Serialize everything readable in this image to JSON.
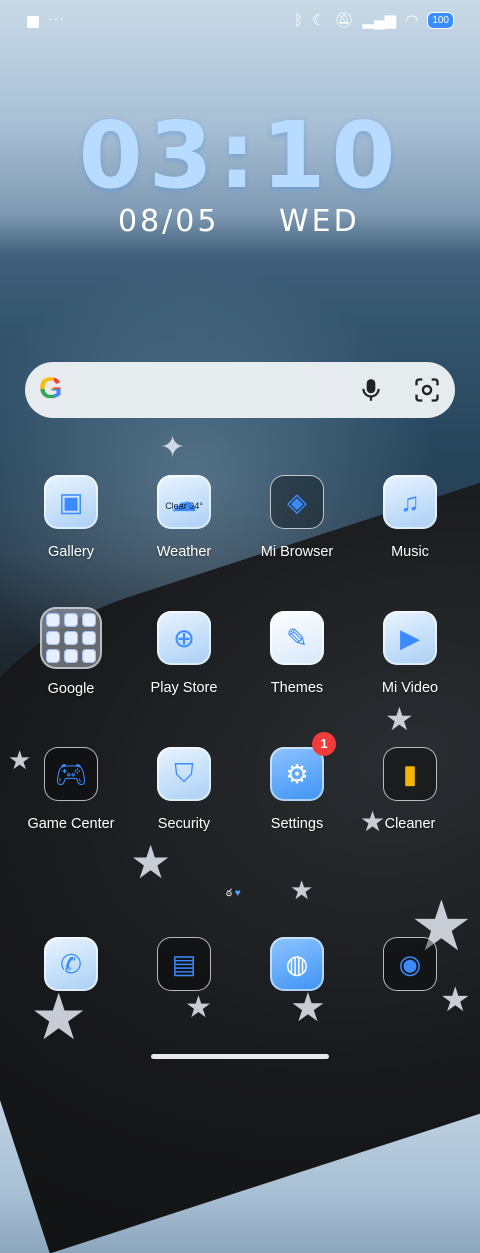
{
  "status_bar": {
    "left_dots": "···",
    "battery": "100",
    "icons": [
      "bluetooth-icon",
      "moon-icon",
      "bell-off-icon",
      "signal-icon",
      "wifi-icon"
    ]
  },
  "lockclock": {
    "time": "03:10",
    "date": "08/05",
    "weekday": "WED"
  },
  "search": {
    "logo": "G",
    "icons": [
      "mic-icon",
      "lens-icon"
    ]
  },
  "apps": [
    {
      "label": "Gallery"
    },
    {
      "label": "Weather",
      "detail": "Clear 34°"
    },
    {
      "label": "Mi Browser"
    },
    {
      "label": "Music"
    },
    {
      "label": "Google"
    },
    {
      "label": "Play Store"
    },
    {
      "label": "Themes"
    },
    {
      "label": "Mi Video"
    },
    {
      "label": "Game Center"
    },
    {
      "label": "Security"
    },
    {
      "label": "Settings",
      "badge": "1"
    },
    {
      "label": "Cleaner"
    }
  ],
  "dock": [
    "phone",
    "messages",
    "browser",
    "camera"
  ],
  "colors": {
    "accent": "#3a8bff",
    "badge": "#f23b3b",
    "clock": "#b7dcff"
  }
}
